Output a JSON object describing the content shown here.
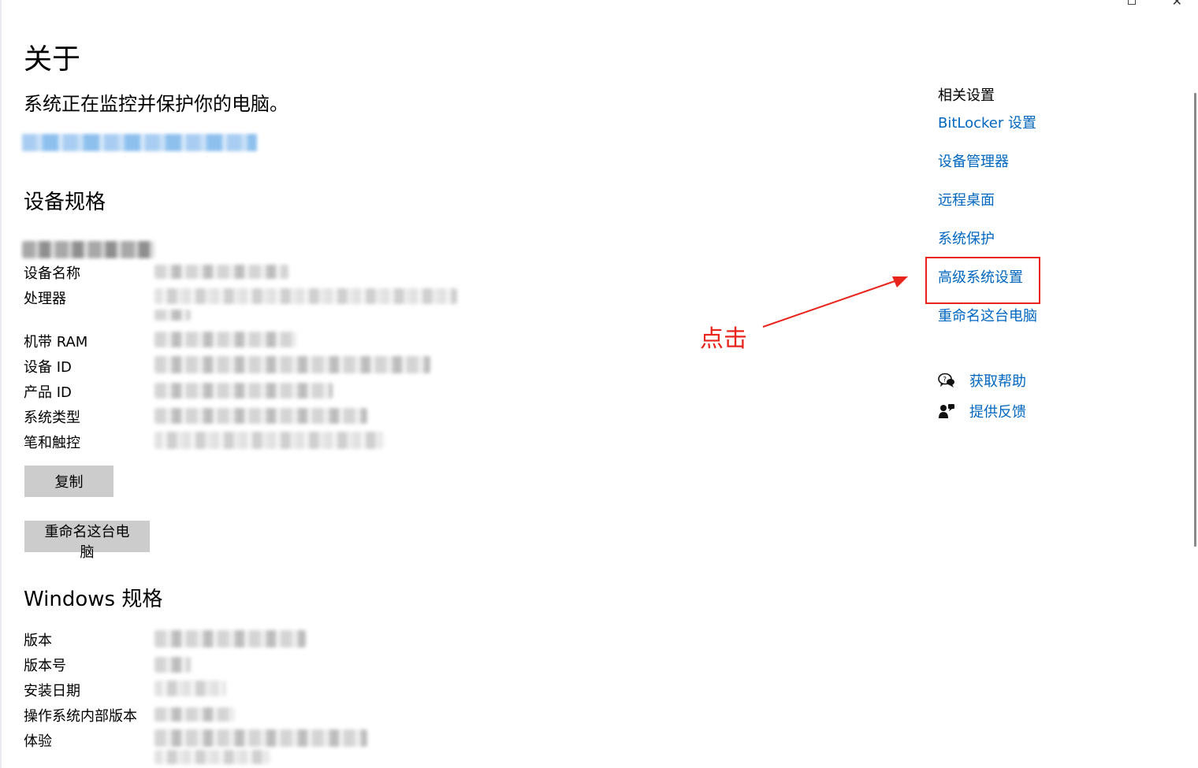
{
  "page": {
    "title": "关于",
    "status": "系统正在监控并保护你的电脑。"
  },
  "device_specs": {
    "heading": "设备规格",
    "labels": {
      "device_name": "设备名称",
      "processor": "处理器",
      "ram": "机带 RAM",
      "device_id": "设备 ID",
      "product_id": "产品 ID",
      "system_type": "系统类型",
      "pen_touch": "笔和触控"
    },
    "copy_button": "复制",
    "rename_button": "重命名这台电脑"
  },
  "windows_specs": {
    "heading": "Windows 规格",
    "labels": {
      "edition": "版本",
      "version": "版本号",
      "install_date": "安装日期",
      "os_build": "操作系统内部版本",
      "experience": "体验"
    }
  },
  "related": {
    "title": "相关设置",
    "links": {
      "bitlocker": "BitLocker 设置",
      "device_manager": "设备管理器",
      "remote_desktop": "远程桌面",
      "system_protection": "系统保护",
      "advanced_system_settings": "高级系统设置",
      "rename_pc": "重命名这台电脑"
    },
    "help": {
      "get_help": "获取帮助",
      "get_help_icon": "chat-help-icon",
      "feedback": "提供反馈",
      "feedback_icon": "feedback-person-icon"
    }
  },
  "annotation": {
    "label": "点击",
    "color": "#e8241c"
  },
  "colors": {
    "link": "#0067c0",
    "button_bg": "#cccccc"
  }
}
